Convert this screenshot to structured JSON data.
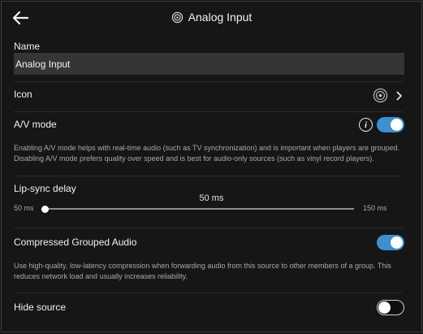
{
  "header": {
    "title": "Analog Input"
  },
  "name": {
    "label": "Name",
    "value": "Analog Input"
  },
  "icon_row": {
    "label": "Icon",
    "icon": "speaker-broadcast-icon"
  },
  "av_mode": {
    "label": "A/V mode",
    "enabled": true,
    "description": "Enabling A/V mode helps with real-time audio (such as TV synchronization) and is important when players are grouped. Disabling A/V mode prefers quality over speed and is best for audio-only sources (such as vinyl record players)."
  },
  "lip_sync": {
    "label": "Lip-sync delay",
    "value_label": "50 ms",
    "min_label": "50 ms",
    "max_label": "150 ms",
    "value": 50,
    "min": 50,
    "max": 150
  },
  "compressed": {
    "label": "Compressed Grouped Audio",
    "enabled": true,
    "description": "Use high-quality, low-latency compression when forwarding audio from this source to other members of a group. This reduces network load and usually increases reliability."
  },
  "hide_source": {
    "label": "Hide source",
    "enabled": false
  },
  "colors": {
    "accent": "#3d8fce",
    "background": "#161616",
    "input": "#353535"
  }
}
